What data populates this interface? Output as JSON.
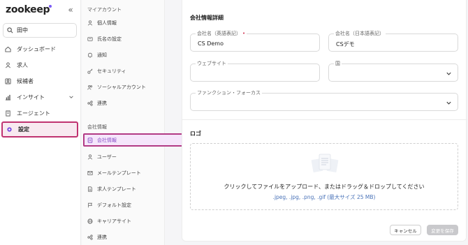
{
  "app": {
    "logo_text": "zookeep"
  },
  "search": {
    "value": "田中",
    "placeholder": ""
  },
  "sidebar": {
    "items": [
      {
        "label": "ダッシュボード",
        "icon": "home-icon"
      },
      {
        "label": "求人",
        "icon": "person-icon"
      },
      {
        "label": "候補者",
        "icon": "people-icon"
      },
      {
        "label": "インサイト",
        "icon": "chart-icon"
      },
      {
        "label": "エージェント",
        "icon": "building-icon"
      },
      {
        "label": "設定",
        "icon": "gear-icon",
        "active": true
      }
    ]
  },
  "settings_nav": {
    "my_account": {
      "title": "マイアカウント",
      "items": [
        "個人情報",
        "氏名の設定",
        "通知",
        "セキュリティ",
        "ソーシャルアカウント",
        "連携"
      ]
    },
    "company": {
      "title": "会社情報",
      "items": [
        "会社情報",
        "ユーザー",
        "メールテンプレート",
        "求人テンプレート",
        "デフォルト設定",
        "キャリアサイト",
        "連携"
      ],
      "active_index": 0
    }
  },
  "form": {
    "title": "会社情報詳細",
    "company_name_en": {
      "label": "会社名（英語表記）",
      "value": "CS Demo",
      "required": true
    },
    "company_name_ja": {
      "label": "会社名（日本語表記）",
      "value": "CSデモ"
    },
    "website": {
      "label": "ウェブサイト",
      "value": ""
    },
    "country": {
      "label": "国",
      "value": ""
    },
    "function_focus": {
      "label": "ファンクション・フォーカス",
      "value": ""
    }
  },
  "logo_section": {
    "title": "ロゴ",
    "dropzone_text": "クリックしてファイルをアップロード、またはドラッグ＆ドロップしてください",
    "dropzone_hint": ".jpeg, .jpg, .png, .gif (最大サイズ 25 MB)"
  },
  "actions": {
    "cancel_label": "キャンセル",
    "save_label": "変更を保存"
  },
  "colors": {
    "active_border": "#c03270",
    "accent_purple": "#8a4fc8",
    "hint_blue": "#4a73b8"
  }
}
